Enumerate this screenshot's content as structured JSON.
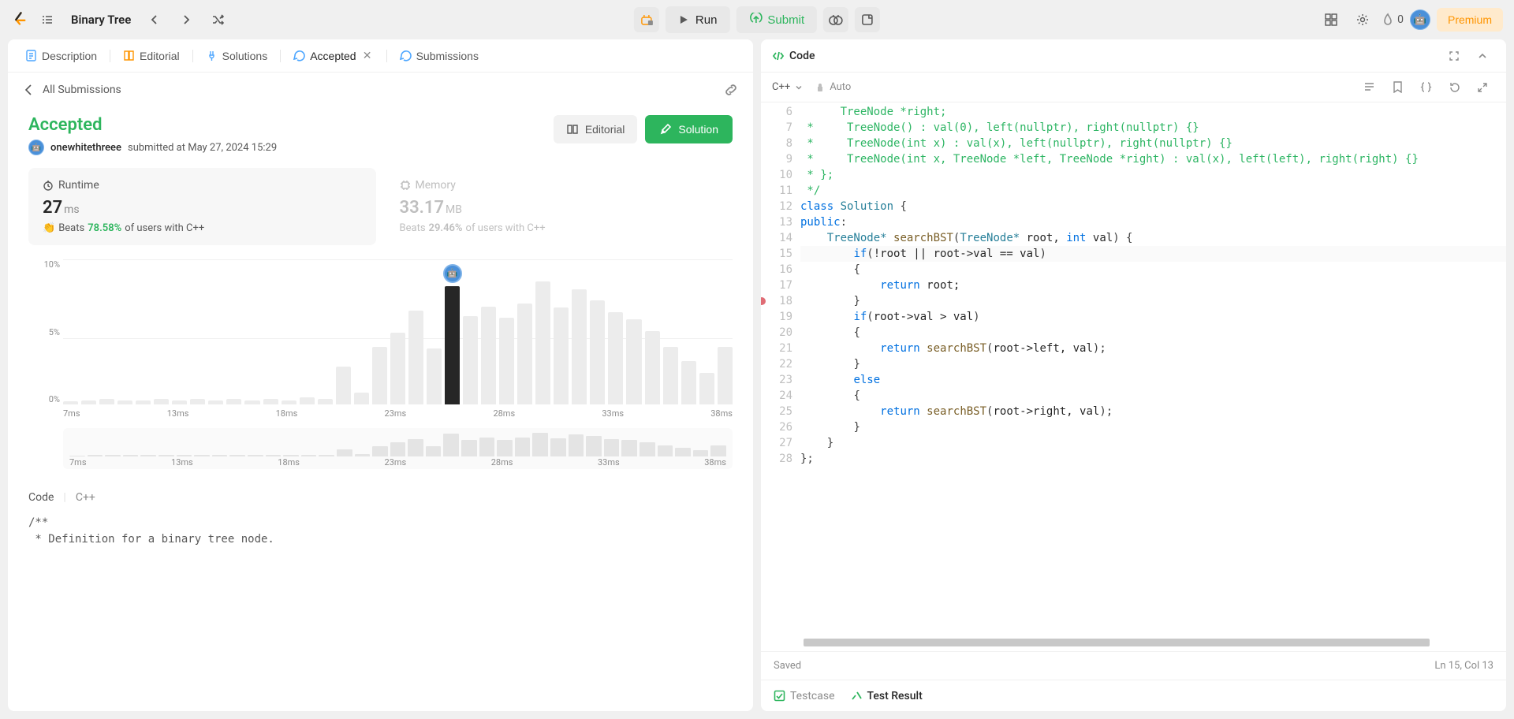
{
  "topbar": {
    "title": "Binary Tree",
    "run_label": "Run",
    "submit_label": "Submit",
    "streak_count": "0",
    "premium_label": "Premium"
  },
  "left_tabs": {
    "description": "Description",
    "editorial": "Editorial",
    "solutions": "Solutions",
    "accepted": "Accepted",
    "submissions": "Submissions"
  },
  "sub_header": {
    "all_submissions": "All Submissions"
  },
  "result": {
    "status": "Accepted",
    "username": "onewhitethreee",
    "submitted_at": "submitted at May 27, 2024 15:29",
    "editorial_btn": "Editorial",
    "solution_btn": "Solution"
  },
  "runtime": {
    "label": "Runtime",
    "value": "27",
    "unit": "ms",
    "beats_prefix": "Beats",
    "beats_pct": "78.58%",
    "beats_suffix": "of users with C++"
  },
  "memory": {
    "label": "Memory",
    "value": "33.17",
    "unit": "MB",
    "beats_prefix": "Beats",
    "beats_pct": "29.46%",
    "beats_suffix": "of users with C++"
  },
  "chart_data": {
    "type": "bar",
    "title": "Runtime distribution",
    "xlabel": "ms",
    "ylabel": "percent",
    "y_ticks": [
      "10%",
      "5%",
      "0%"
    ],
    "x_ticks": [
      "7ms",
      "13ms",
      "18ms",
      "23ms",
      "28ms",
      "33ms",
      "38ms"
    ],
    "highlight_index": 21,
    "values": [
      0.2,
      0.3,
      0.4,
      0.3,
      0.3,
      0.4,
      0.3,
      0.4,
      0.3,
      0.4,
      0.3,
      0.4,
      0.3,
      0.5,
      0.4,
      2.6,
      0.8,
      4.0,
      5.0,
      6.5,
      3.9,
      8.2,
      6.1,
      6.8,
      6.0,
      7.0,
      8.5,
      6.7,
      8.0,
      7.2,
      6.4,
      5.9,
      5.1,
      4.0,
      3.0,
      2.2,
      4.0
    ],
    "overview_values": [
      2,
      3,
      3,
      3,
      3,
      3,
      3,
      3,
      3,
      3,
      3,
      3,
      3,
      4,
      4,
      16,
      5,
      24,
      32,
      40,
      24,
      52,
      38,
      44,
      38,
      44,
      54,
      42,
      50,
      46,
      40,
      38,
      32,
      26,
      20,
      14,
      26
    ]
  },
  "code_sec": {
    "label1": "Code",
    "label2": "C++",
    "preview": "/**\n * Definition for a binary tree node."
  },
  "right": {
    "code_tab": "Code",
    "language": "C++",
    "auto": "Auto",
    "saved": "Saved",
    "cursor": "Ln 15, Col 13",
    "testcase": "Testcase",
    "test_result": "Test Result"
  },
  "code_lines": [
    {
      "n": 6,
      "html": "<span class='c-comment'>      TreeNode *right;</span>"
    },
    {
      "n": 7,
      "html": "<span class='c-comment'> *     TreeNode() : val(0), left(nullptr), right(nullptr) {}</span>"
    },
    {
      "n": 8,
      "html": "<span class='c-comment'> *     TreeNode(int x) : val(x), left(nullptr), right(nullptr) {}</span>"
    },
    {
      "n": 9,
      "html": "<span class='c-comment'> *     TreeNode(int x, TreeNode *left, TreeNode *right) : val(x), left(left), right(right) {}</span>"
    },
    {
      "n": 10,
      "html": "<span class='c-comment'> * };</span>"
    },
    {
      "n": 11,
      "html": "<span class='c-comment'> */</span>"
    },
    {
      "n": 12,
      "html": "<span class='c-keyword'>class</span> <span class='c-type'>Solution</span> <span class='c-punc'>{</span>"
    },
    {
      "n": 13,
      "html": "<span class='c-keyword'>public</span><span class='c-punc'>:</span>"
    },
    {
      "n": 14,
      "html": "    <span class='c-type'>TreeNode*</span> <span class='c-func'>searchBST</span><span class='c-punc'>(</span><span class='c-type'>TreeNode*</span> root, <span class='c-keyword'>int</span> val<span class='c-punc'>) {</span>"
    },
    {
      "n": 15,
      "current": true,
      "html": "        <span class='c-keyword'>if</span><span class='c-punc'>(</span>!root || root-&gt;val == val<span class='c-punc'>)</span>"
    },
    {
      "n": 16,
      "html": "        <span class='c-punc'>{</span>"
    },
    {
      "n": 17,
      "html": "            <span class='c-keyword'>return</span> root;"
    },
    {
      "n": 18,
      "bp": true,
      "html": "        <span class='c-punc'>}</span>"
    },
    {
      "n": 19,
      "html": "        <span class='c-keyword'>if</span><span class='c-punc'>(</span>root-&gt;val &gt; val<span class='c-punc'>)</span>"
    },
    {
      "n": 20,
      "html": "        <span class='c-punc'>{</span>"
    },
    {
      "n": 21,
      "html": "            <span class='c-keyword'>return</span> <span class='c-func'>searchBST</span><span class='c-punc'>(</span>root-&gt;left, val<span class='c-punc'>);</span>"
    },
    {
      "n": 22,
      "html": "        <span class='c-punc'>}</span>"
    },
    {
      "n": 23,
      "html": "        <span class='c-keyword'>else</span>"
    },
    {
      "n": 24,
      "html": "        <span class='c-punc'>{</span>"
    },
    {
      "n": 25,
      "html": "            <span class='c-keyword'>return</span> <span class='c-func'>searchBST</span><span class='c-punc'>(</span>root-&gt;right, val<span class='c-punc'>);</span>"
    },
    {
      "n": 26,
      "html": "        <span class='c-punc'>}</span>"
    },
    {
      "n": 27,
      "html": "    <span class='c-punc'>}</span>"
    },
    {
      "n": 28,
      "html": "<span class='c-punc'>};</span>"
    }
  ]
}
